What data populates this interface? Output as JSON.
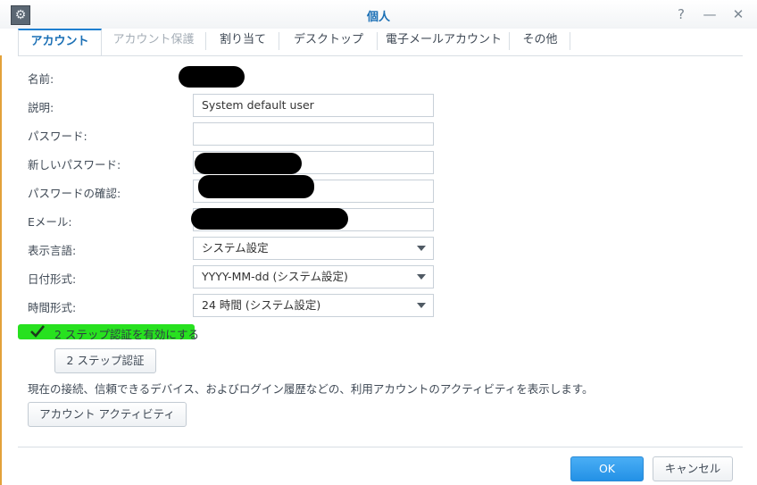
{
  "window": {
    "title": "個人",
    "app_icon": "gears-icon",
    "help_glyph": "?",
    "minimize_glyph": "—",
    "close_glyph": "✕"
  },
  "tabs": [
    {
      "label": "アカウント",
      "state": "active"
    },
    {
      "label": "アカウント保護",
      "state": "disabled"
    },
    {
      "label": "割り当て",
      "state": "normal"
    },
    {
      "label": "デスクトップ",
      "state": "normal"
    },
    {
      "label": "電子メールアカウント",
      "state": "normal"
    },
    {
      "label": "その他",
      "state": "normal"
    }
  ],
  "form": {
    "name": {
      "label": "名前:",
      "value_redacted": true
    },
    "description": {
      "label": "説明:",
      "value": "System default user"
    },
    "password": {
      "label": "パスワード:",
      "value": ""
    },
    "new_password": {
      "label": "新しいパスワード:",
      "value_redacted": true
    },
    "confirm_password": {
      "label": "パスワードの確認:",
      "value_redacted": true
    },
    "email": {
      "label": "Eメール:",
      "value_redacted": true
    },
    "language": {
      "label": "表示言語:",
      "value": "システム設定"
    },
    "date_format": {
      "label": "日付形式:",
      "value": "YYYY-MM-dd (システム設定)"
    },
    "time_format": {
      "label": "時間形式:",
      "value": "24 時間 (システム設定)"
    }
  },
  "two_step": {
    "checkbox_label": "2 ステップ認証を有効にする",
    "checked": true,
    "highlight_color": "#27e11f",
    "button_label": "2 ステップ認証"
  },
  "activity": {
    "info_text": "現在の接続、信頼できるデバイス、およびログイン履歴などの、利用アカウントのアクティビティを表示します。",
    "button_label": "アカウント アクティビティ"
  },
  "footer": {
    "ok_label": "OK",
    "cancel_label": "キャンセル"
  },
  "colors": {
    "accent": "#1f7fd0",
    "ok_button": "#2391e6",
    "redaction": "#000000"
  }
}
